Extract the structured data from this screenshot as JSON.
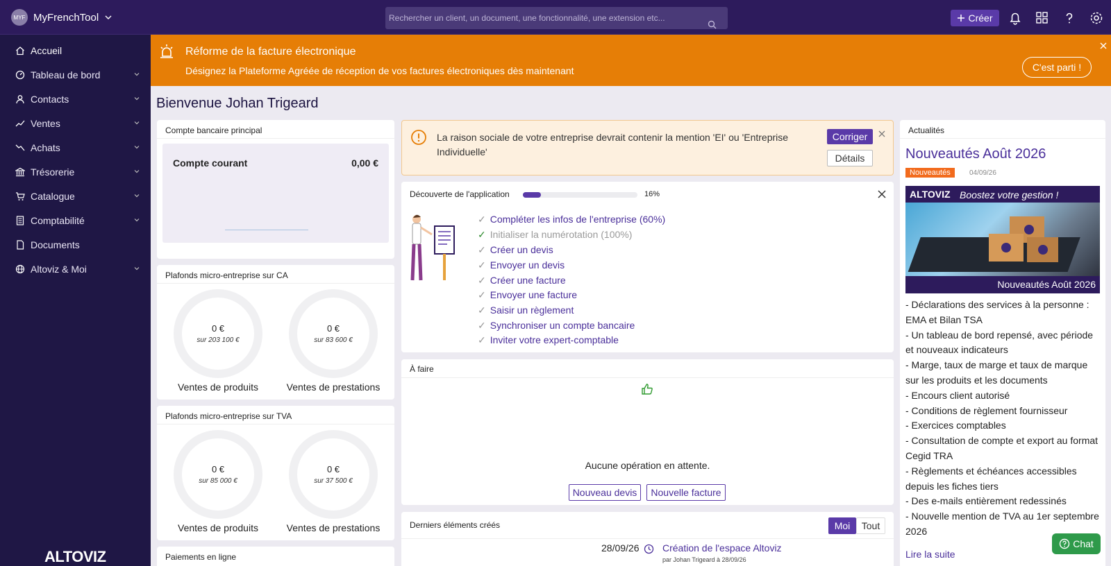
{
  "topbar": {
    "avatar_initials": "MYF",
    "app_name": "MyFrenchTool",
    "search_placeholder": "Rechercher un client, un document, une fonctionnalité, une extension etc...",
    "create_label": "Créer"
  },
  "sidebar": {
    "items": [
      {
        "label": "Accueil",
        "icon": "home-icon"
      },
      {
        "label": "Tableau de bord",
        "icon": "dashboard-icon"
      },
      {
        "label": "Contacts",
        "icon": "user-icon"
      },
      {
        "label": "Ventes",
        "icon": "trend-up-icon"
      },
      {
        "label": "Achats",
        "icon": "trend-down-icon"
      },
      {
        "label": "Trésorerie",
        "icon": "bank-icon"
      },
      {
        "label": "Catalogue",
        "icon": "cart-icon"
      },
      {
        "label": "Comptabilité",
        "icon": "calculator-icon"
      },
      {
        "label": "Documents",
        "icon": "document-icon"
      },
      {
        "label": "Altoviz & Moi",
        "icon": "globe-icon"
      }
    ],
    "logo": "ALTOVIZ"
  },
  "banner": {
    "title": "Réforme de la facture électronique",
    "subtitle": "Désignez la Plateforme Agréée de réception de vos factures électroniques dès maintenant",
    "cta": "C'est parti !"
  },
  "welcome": "Bienvenue Johan Trigeard",
  "bank": {
    "title": "Compte bancaire principal",
    "account": "Compte courant",
    "amount": "0,00 €"
  },
  "ca": {
    "title": "Plafonds micro-entreprise sur CA",
    "rings": [
      {
        "amount": "0 €",
        "limit": "sur 203 100 €",
        "label": "Ventes de produits",
        "fill": 0
      },
      {
        "amount": "0 €",
        "limit": "sur 83 600 €",
        "label": "Ventes de prestations",
        "fill": 0
      }
    ]
  },
  "tva": {
    "title": "Plafonds micro-entreprise sur TVA",
    "rings": [
      {
        "amount": "0 €",
        "limit": "sur 85 000 €",
        "label": "Ventes de produits",
        "fill": 0
      },
      {
        "amount": "0 €",
        "limit": "sur 37 500 €",
        "label": "Ventes de prestations",
        "fill": 0
      }
    ]
  },
  "payments": {
    "title": "Paiements en ligne"
  },
  "alert": {
    "text": "La raison sociale de votre entreprise devrait contenir la mention 'EI' ou 'Entreprise Individuelle'",
    "fix": "Corriger",
    "details": "Détails"
  },
  "discovery": {
    "title": "Découverte de l'application",
    "progress": 16,
    "progress_label": "16%",
    "steps": [
      {
        "label": "Compléter les infos de l'entreprise (60%)",
        "done": false
      },
      {
        "label": "Initialiser la numérotation (100%)",
        "done": true
      },
      {
        "label": "Créer un devis",
        "done": false
      },
      {
        "label": "Envoyer un devis",
        "done": false
      },
      {
        "label": "Créer une facture",
        "done": false
      },
      {
        "label": "Envoyer une facture",
        "done": false
      },
      {
        "label": "Saisir un règlement",
        "done": false
      },
      {
        "label": "Synchroniser un compte bancaire",
        "done": false
      },
      {
        "label": "Inviter votre expert-comptable",
        "done": false
      }
    ]
  },
  "todo": {
    "title": "À faire",
    "empty": "Aucune opération en attente.",
    "new_quote": "Nouveau devis",
    "new_invoice": "Nouvelle facture"
  },
  "recent": {
    "title": "Derniers éléments créés",
    "toggle_me": "Moi",
    "toggle_all": "Tout",
    "items": [
      {
        "date": "28/09/26",
        "label": "Création de l'espace Altoviz",
        "by": "par Johan Trigeard à 28/09/26"
      }
    ]
  },
  "news": {
    "title": "Actualités",
    "headline": "Nouveautés Août 2026",
    "badge": "Nouveautés",
    "date": "04/09/26",
    "image_brand": "ALTOVIZ",
    "image_tagline": "Boostez votre gestion !",
    "image_caption": "Nouveautés Août 2026",
    "lines": [
      "- Déclarations des services à la personne : EMA et Bilan TSA",
      "- Un tableau de bord repensé, avec période et nouveaux indicateurs",
      "- Marge, taux de marge et taux de marque sur les produits et les documents",
      "- Encours client autorisé",
      "- Conditions de règlement fournisseur",
      "- Exercices comptables",
      "- Consultation de compte et export au format Cegid TRA",
      "- Règlements et échéances accessibles depuis les fiches tiers",
      "- Des e-mails entièrement redessinés",
      "- Nouvelle mention de TVA au 1er septembre 2026"
    ],
    "read_more": "Lire la suite"
  },
  "chat": {
    "label": "Chat"
  },
  "colors": {
    "primary": "#5a3aa8",
    "sidebar": "#1f1745",
    "topbar": "#2d1b5c",
    "banner": "#e67e06",
    "badge": "#f26b1d"
  }
}
